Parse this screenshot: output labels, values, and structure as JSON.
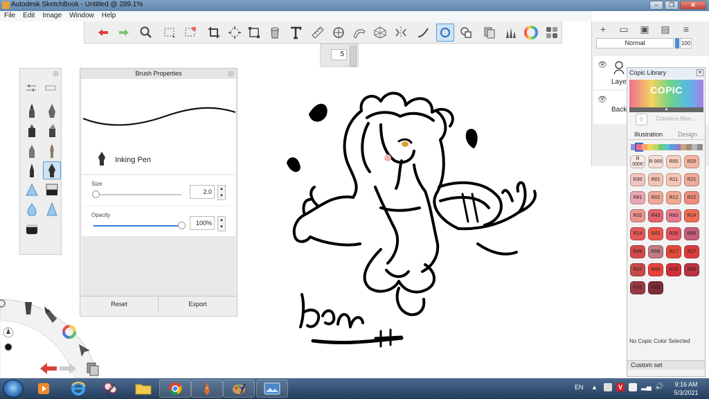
{
  "window": {
    "title": "Autodesk SketchBook - Untitled @ 289.1%",
    "controls": [
      "minimize",
      "maximize",
      "close"
    ]
  },
  "menu": [
    "File",
    "Edit",
    "Image",
    "Window",
    "Help"
  ],
  "toolbar": {
    "tools": [
      "undo-icon",
      "redo-icon",
      "zoom-icon",
      "rect-select-icon",
      "lasso-select-icon",
      "crop-icon",
      "transform-icon",
      "perspective-icon",
      "fill-icon",
      "text-icon",
      "ruler-icon",
      "ellipse-guide-icon",
      "french-curve-icon",
      "perspective-grid-icon",
      "symmetry-icon",
      "stroke-icon",
      "predictive-stroke-icon",
      "shape-icon",
      "copy-icon",
      "brush-library-icon",
      "color-wheel-icon",
      "copic-icon"
    ],
    "active_tool": "predictive-stroke-icon",
    "brush_size_popup": "5"
  },
  "layers": {
    "blend_mode": "Normal",
    "opacity": "100",
    "items": [
      {
        "name": "Layer",
        "visible": true
      },
      {
        "name": "Background",
        "visible": true
      }
    ]
  },
  "copic_library": {
    "title": "Copic Library",
    "logo_text": "COPIC",
    "colorless_chip": "0",
    "colorless_label": "Colorless Blen...",
    "tabs": [
      "Illustration",
      "Design"
    ],
    "active_tab": "Illustration",
    "swatches": [
      {
        "code": "R 0000",
        "color": "#f9e9e2"
      },
      {
        "code": "R 000",
        "color": "#f6dcd2"
      },
      {
        "code": "R00",
        "color": "#f6cdbf"
      },
      {
        "code": "R20",
        "color": "#f4b4a2"
      },
      {
        "code": "R30",
        "color": "#f3c3c0"
      },
      {
        "code": "R01",
        "color": "#f3c2b5"
      },
      {
        "code": "R11",
        "color": "#f5c6b5"
      },
      {
        "code": "R21",
        "color": "#f0a99c"
      },
      {
        "code": "R81",
        "color": "#eba5b3"
      },
      {
        "code": "R02",
        "color": "#f0a797"
      },
      {
        "code": "R12",
        "color": "#f2a88e"
      },
      {
        "code": "R22",
        "color": "#ee8c7d"
      },
      {
        "code": "R32",
        "color": "#ec9591"
      },
      {
        "code": "R43",
        "color": "#e46370"
      },
      {
        "code": "R83",
        "color": "#e77b8f"
      },
      {
        "code": "R14",
        "color": "#ee6c55"
      },
      {
        "code": "R24",
        "color": "#e35a57"
      },
      {
        "code": "R05",
        "color": "#e8584a"
      },
      {
        "code": "R35",
        "color": "#e2555f"
      },
      {
        "code": "R85",
        "color": "#c3607a"
      },
      {
        "code": "R46",
        "color": "#d34a4d"
      },
      {
        "code": "R56",
        "color": "#c07c83"
      },
      {
        "code": "R17",
        "color": "#e24a38"
      },
      {
        "code": "R27",
        "color": "#dc3c3e"
      },
      {
        "code": "R37",
        "color": "#c64a4a"
      },
      {
        "code": "R08",
        "color": "#e8433c"
      },
      {
        "code": "R29",
        "color": "#d12f3b"
      },
      {
        "code": "R39",
        "color": "#b83343"
      },
      {
        "code": "R59",
        "color": "#9b3a42"
      },
      {
        "code": "R89",
        "color": "#7c2f36"
      }
    ],
    "no_selection": "No Copic Color Selected",
    "custom_set": "Custom set"
  },
  "brush_properties": {
    "title": "Brush Properties",
    "brush_name": "Inking Pen",
    "size_label": "Size",
    "size_value": "2.0",
    "size_fraction": 0.02,
    "opacity_label": "Opacity",
    "opacity_value": "100%",
    "opacity_fraction": 1.0,
    "reset_label": "Reset",
    "export_label": "Export"
  },
  "taskbar": {
    "apps": [
      "start-orb",
      "media-player-icon",
      "internet-explorer-icon",
      "paint-tool-icon",
      "file-explorer-icon",
      "chrome-icon",
      "sketchbook-icon",
      "art-program-icon",
      "photo-viewer-icon"
    ],
    "language": "EN",
    "time": "9:16 AM",
    "date": "5/3/2021"
  },
  "accent_color": "#4a8fd6"
}
